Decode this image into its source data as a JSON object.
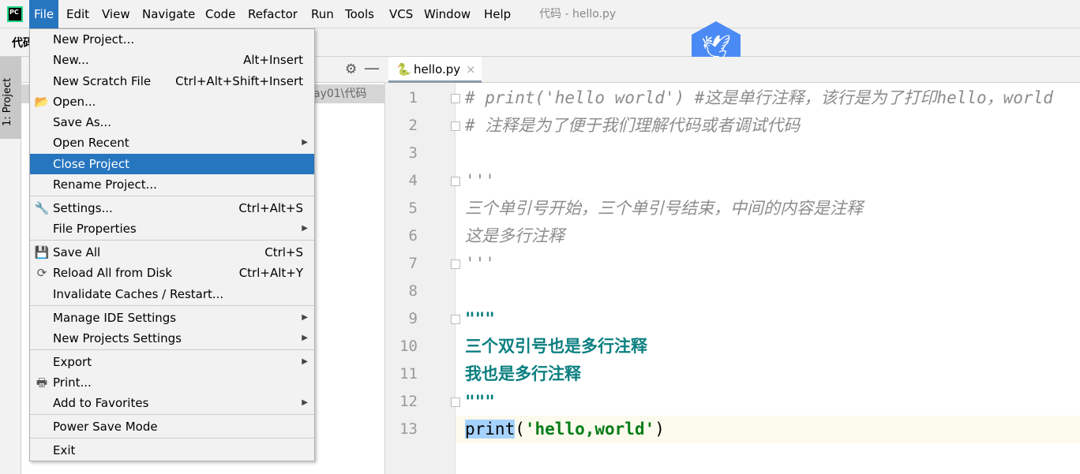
{
  "menubar": {
    "items": [
      "File",
      "Edit",
      "View",
      "Navigate",
      "Code",
      "Refactor",
      "Run",
      "Tools",
      "VCS",
      "Window",
      "Help"
    ],
    "window_title": "代码 - hello.py"
  },
  "toolbar": {
    "project_name": "代码"
  },
  "sidebar": {
    "project_tab": "1: Project",
    "path": "ay01\\代码"
  },
  "editor": {
    "tab": "hello.py",
    "lines": [
      "# print('hello world')  #这是单行注释，该行是为了打印hello，world",
      "# 注释是为了便于我们理解代码或者调试代码",
      "",
      "'''",
      "三个单引号开始，三个单引号结束，中间的内容是注释",
      "这是多行注释",
      "'''",
      "",
      "\"\"\"",
      "三个双引号也是多行注释",
      "我也是多行注释",
      "\"\"\"",
      ""
    ],
    "line13": {
      "func": "print",
      "open": "(",
      "string": "'hello,world'",
      "close": ")"
    }
  },
  "file_menu": {
    "items": [
      {
        "label": "New Project...",
        "shortcut": ""
      },
      {
        "label": "New...",
        "shortcut": "Alt+Insert"
      },
      {
        "label": "New Scratch File",
        "shortcut": "Ctrl+Alt+Shift+Insert"
      },
      {
        "label": "Open...",
        "shortcut": "",
        "icon": "folder-icon"
      },
      {
        "label": "Save As...",
        "shortcut": ""
      },
      {
        "label": "Open Recent",
        "shortcut": "",
        "submenu": true
      },
      {
        "label": "Close Project",
        "shortcut": "",
        "highlighted": true
      },
      {
        "label": "Rename Project...",
        "shortcut": ""
      },
      {
        "label": "Settings...",
        "shortcut": "Ctrl+Alt+S",
        "icon": "wrench-icon"
      },
      {
        "label": "File Properties",
        "shortcut": "",
        "submenu": true
      },
      {
        "label": "Save All",
        "shortcut": "Ctrl+S",
        "icon": "save-icon"
      },
      {
        "label": "Reload All from Disk",
        "shortcut": "Ctrl+Alt+Y",
        "icon": "reload-icon"
      },
      {
        "label": "Invalidate Caches / Restart...",
        "shortcut": ""
      },
      {
        "label": "Manage IDE Settings",
        "shortcut": "",
        "submenu": true
      },
      {
        "label": "New Projects Settings",
        "shortcut": "",
        "submenu": true
      },
      {
        "label": "Export",
        "shortcut": "",
        "submenu": true
      },
      {
        "label": "Print...",
        "shortcut": "",
        "icon": "print-icon"
      },
      {
        "label": "Add to Favorites",
        "shortcut": "",
        "submenu": true
      },
      {
        "label": "Power Save Mode",
        "shortcut": ""
      },
      {
        "label": "Exit",
        "shortcut": ""
      }
    ]
  },
  "colors": {
    "accent": "#2675bf",
    "comment": "#8c8c8c",
    "docstring": "#0b7f80",
    "string": "#067d17"
  }
}
